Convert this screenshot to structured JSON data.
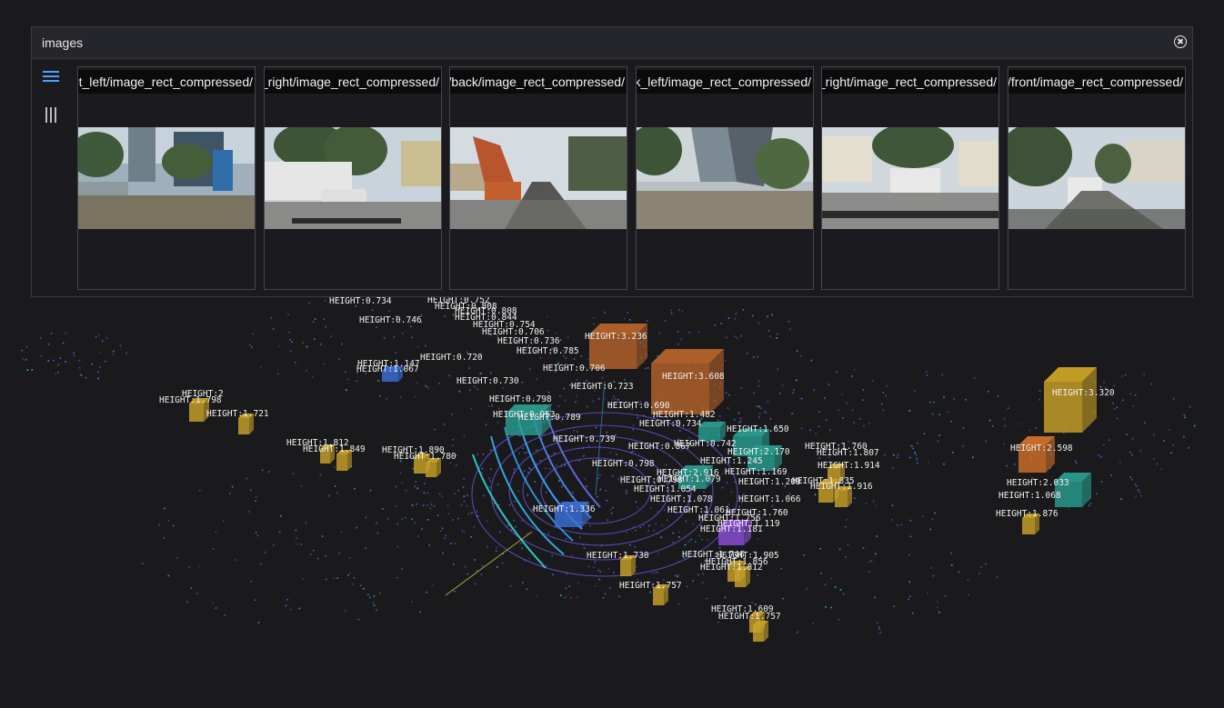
{
  "panel": {
    "title": "images",
    "cameras": [
      {
        "topic": "/camera/front_left/image_rect_compressed"
      },
      {
        "topic": "/camera/front_right/image_rect_compressed"
      },
      {
        "topic": "/camera/back/image_rect_compressed"
      },
      {
        "topic": "/camera/back_left/image_rect_compressed"
      },
      {
        "topic": "/camera/back_right/image_rect_compressed"
      },
      {
        "topic": "/camera/front/image_rect_compressed"
      }
    ]
  },
  "labels": [
    "HEIGHT:0.734",
    "HEIGHT:0.752",
    "HEIGHT:0.808",
    "HEIGHT:0.808",
    "HEIGHT:0.746",
    "HEIGHT:0.844",
    "HEIGHT:0.754",
    "HEIGHT:0.706",
    "HEIGHT:0.736",
    "HEIGHT:0.785",
    "HEIGHT:3.236",
    "HEIGHT:0.720",
    "HEIGHT:1.147",
    "HEIGHT:1.067",
    "HEIGHT:0.706",
    "HEIGHT:3.608",
    "HEIGHT:0.730",
    "HEIGHT:0.723",
    "HEIGHT:2",
    "HEIGHT:1.798",
    "HEIGHT:0.798",
    "HEIGHT:0.690",
    "HEIGHT:1.721",
    "HEIGHT:0.953",
    "HEIGHT:0.789",
    "HEIGHT:1.482",
    "HEIGHT:0.734",
    "HEIGHT:1.650",
    "HEIGHT:3.320",
    "HEIGHT:0.739",
    "HEIGHT:1.812",
    "HEIGHT:1.849",
    "HEIGHT:1.890",
    "HEIGHT:1.780",
    "HEIGHT:0.742",
    "HEIGHT:0.867",
    "HEIGHT:2.170",
    "HEIGHT:1.760",
    "HEIGHT:1.807",
    "HEIGHT:2.598",
    "HEIGHT:1.914",
    "HEIGHT:0.798",
    "HEIGHT:0.798",
    "HEIGHT:1.245",
    "HEIGHT:2.916",
    "HEIGHT:1.169",
    "HEIGHT:1.079",
    "HEIGHT:1.209",
    "HEIGHT:1.835",
    "HEIGHT:1.916",
    "HEIGHT:2.033",
    "HEIGHT:1.054",
    "HEIGHT:1.068",
    "HEIGHT:1.078",
    "HEIGHT:1.066",
    "HEIGHT:1.336",
    "HEIGHT:1.061",
    "HEIGHT:1.760",
    "HEIGHT:1.876",
    "HEIGHT:1.756",
    "HEIGHT:1.119",
    "HEIGHT:1.181",
    "HEIGHT:1.730",
    "HEIGHT:1.746",
    "HEIGHT:1.905",
    "HEIGHT:1.856",
    "HEIGHT:1.812",
    "HEIGHT:1.757",
    "HEIGHT:1.609",
    "HEIGHT:1.757"
  ]
}
